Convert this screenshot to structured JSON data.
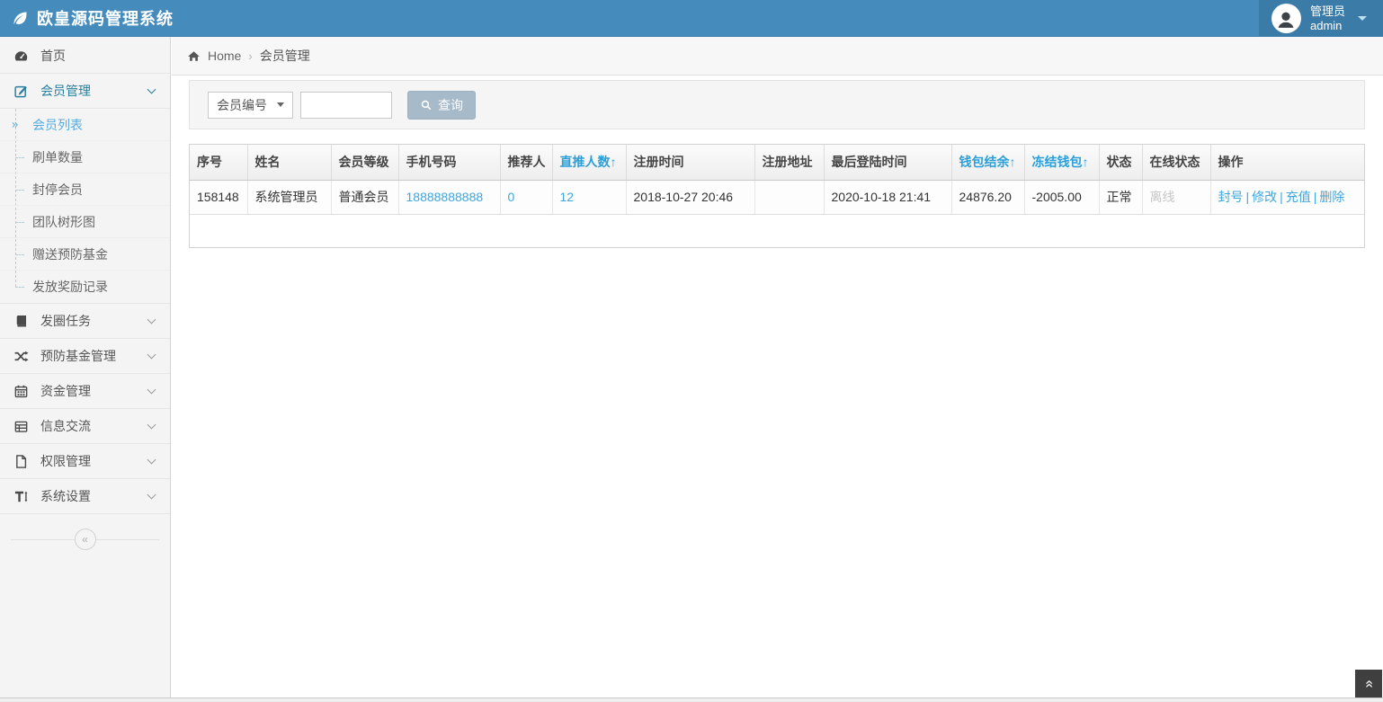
{
  "colors": {
    "navbar": "#458cbd",
    "navbar_user": "#3a7ba8",
    "accent_link": "#3ea6dc",
    "sortable_header": "#2b9fd9",
    "active_parent": "#26809e",
    "active_child": "#54ace0",
    "button_bg": "#a6bac9"
  },
  "icons": {
    "logo": "leaf-icon",
    "menu_home": "dashboard-icon",
    "menu_member_management": "edit-icon",
    "menu_moments_task": "book-icon",
    "menu_prevention_fund": "shuffle-icon",
    "menu_funds_management": "calendar-icon",
    "menu_info_exchange": "list-icon",
    "menu_permission_management": "file-icon",
    "menu_system_settings": "text-height-icon",
    "breadcrumb_home": "home-icon",
    "search_button": "search-icon",
    "navbar_user": "user-avatar-icon",
    "sidebar_collapse": "double-angle-left-icon",
    "back_to_top": "double-angle-up-icon"
  },
  "app": {
    "title": "欧皇源码管理系统"
  },
  "navbar": {
    "user_role": "管理员",
    "user_name": "admin"
  },
  "sidebar": {
    "items": [
      {
        "label": "首页"
      },
      {
        "label": "会员管理",
        "children": [
          "会员列表",
          "刷单数量",
          "封停会员",
          "团队树形图",
          "赠送预防基金",
          "发放奖励记录"
        ]
      },
      {
        "label": "发圈任务"
      },
      {
        "label": "预防基金管理"
      },
      {
        "label": "资金管理"
      },
      {
        "label": "信息交流"
      },
      {
        "label": "权限管理"
      },
      {
        "label": "系统设置"
      }
    ],
    "collapse_icon": "«"
  },
  "breadcrumb": {
    "home": "Home",
    "separator": "›",
    "current": "会员管理"
  },
  "search": {
    "filter_selected": "会员编号",
    "input_value": "",
    "button_label": "查询"
  },
  "table": {
    "columns": [
      {
        "label": "序号"
      },
      {
        "label": "姓名"
      },
      {
        "label": "会员等级"
      },
      {
        "label": "手机号码"
      },
      {
        "label": "推荐人"
      },
      {
        "label": "直推人数",
        "sort": "↑"
      },
      {
        "label": "注册时间"
      },
      {
        "label": "注册地址"
      },
      {
        "label": "最后登陆时间"
      },
      {
        "label": "钱包结余",
        "sort": "↑"
      },
      {
        "label": "冻结钱包",
        "sort": "↑"
      },
      {
        "label": "状态"
      },
      {
        "label": "在线状态"
      },
      {
        "label": "操作"
      }
    ],
    "action_separator": "|",
    "rows": [
      {
        "seq": "158148",
        "name": "系统管理员",
        "level": "普通会员",
        "phone": "18888888888",
        "referrer": "0",
        "direct_push_count": "12",
        "register_time": "2018-10-27 20:46",
        "register_address": "",
        "last_login_time": "2020-10-18 21:41",
        "wallet_balance": "24876.20",
        "frozen_wallet": "-2005.00",
        "status": "正常",
        "online_status": "离线",
        "actions": [
          "封号",
          "修改",
          "充值",
          "删除"
        ]
      }
    ]
  },
  "back_to_top_icon": "«"
}
